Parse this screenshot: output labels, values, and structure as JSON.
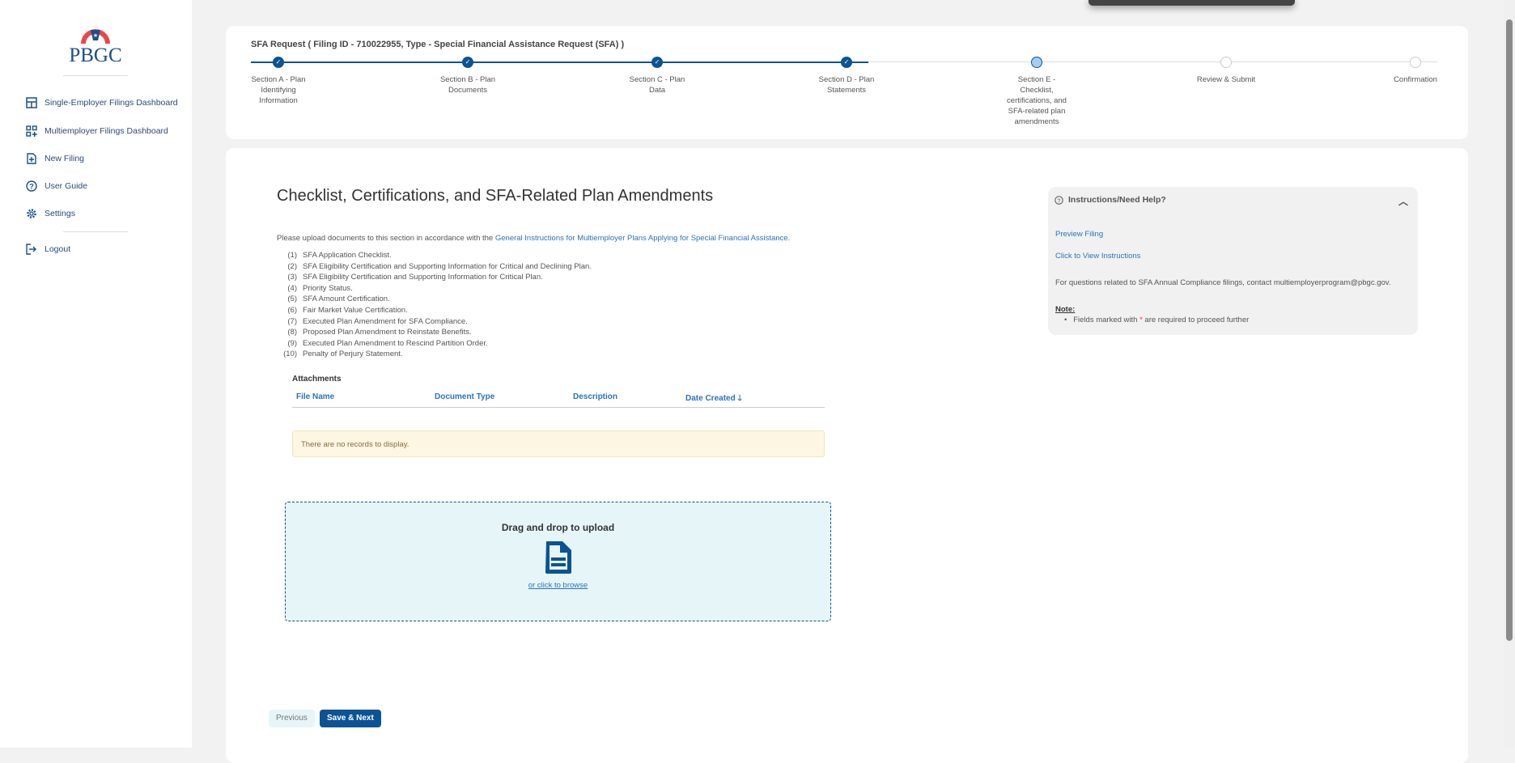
{
  "brand": {
    "logo_text": "PBGC",
    "primary": "#0b5394"
  },
  "sidebar": {
    "items": [
      {
        "label": "Single-Employer Filings Dashboard",
        "icon": "dashboard-icon"
      },
      {
        "label": "Multiemployer Filings Dashboard",
        "icon": "grid-plus-icon"
      },
      {
        "label": "New Filing",
        "icon": "file-plus-icon"
      },
      {
        "label": "User Guide",
        "icon": "question-circle-icon"
      },
      {
        "label": "Settings",
        "icon": "gear-icon"
      }
    ],
    "logout": "Logout"
  },
  "header": {
    "title": "SFA Request ( Filing ID - 710022955, Type - Special Financial Assistance Request (SFA) )",
    "steps": [
      {
        "label": "Section A - Plan Identifying Information",
        "status": "complete"
      },
      {
        "label": "Section B - Plan Documents",
        "status": "complete"
      },
      {
        "label": "Section C - Plan Data",
        "status": "complete"
      },
      {
        "label": "Section D - Plan Statements",
        "status": "complete"
      },
      {
        "label": "Section E - Checklist, certifications, and SFA-related plan amendments",
        "status": "current"
      },
      {
        "label": "Review & Submit",
        "status": "pending"
      },
      {
        "label": "Confirmation",
        "status": "pending"
      }
    ]
  },
  "main": {
    "heading": "Checklist, Certifications, and SFA-Related Plan Amendments",
    "intro": "Please upload documents to this section in accordance with the ",
    "intro_link": "General Instructions for Multiemployer Plans Applying for Special Financial Assistance.",
    "items": [
      {
        "n": "(1)",
        "t": "SFA Application Checklist."
      },
      {
        "n": "(2)",
        "t": "SFA Eligibility Certification and Supporting Information for Critical and Declining Plan."
      },
      {
        "n": "(3)",
        "t": "SFA Eligibility Certification and Supporting Information for Critical Plan."
      },
      {
        "n": "(4)",
        "t": "Priority Status."
      },
      {
        "n": "(5)",
        "t": "SFA Amount Certification."
      },
      {
        "n": "(6)",
        "t": "Fair Market Value Certification."
      },
      {
        "n": "(7)",
        "t": "Executed Plan Amendment for SFA Compliance."
      },
      {
        "n": "(8)",
        "t": "Proposed Plan Amendment to Reinstate Benefits."
      },
      {
        "n": "(9)",
        "t": "Executed Plan Amendment to Rescind Partition Order."
      },
      {
        "n": "(10)",
        "t": "Penalty of Perjury Statement."
      }
    ],
    "attachments": {
      "label": "Attachments",
      "columns": [
        "File Name",
        "Document Type",
        "Description",
        "Date Created"
      ],
      "sort": "Date Created descending",
      "empty": "There are no records to display."
    },
    "upload": {
      "title": "Drag and drop to upload",
      "browse": "or click to browse"
    },
    "previous": "Previous",
    "save_next": "Save & Next"
  },
  "help": {
    "title": "Instructions/Need Help?",
    "preview": "Preview Filing",
    "view_instructions": "Click to View Instructions",
    "contact": "For questions related to SFA Annual Compliance filings, contact multiemployerprogram@pbgc.gov.",
    "note_label": "Note:",
    "note_pre": "Fields marked with ",
    "note_star": "*",
    "note_post": " are required to proceed further"
  }
}
